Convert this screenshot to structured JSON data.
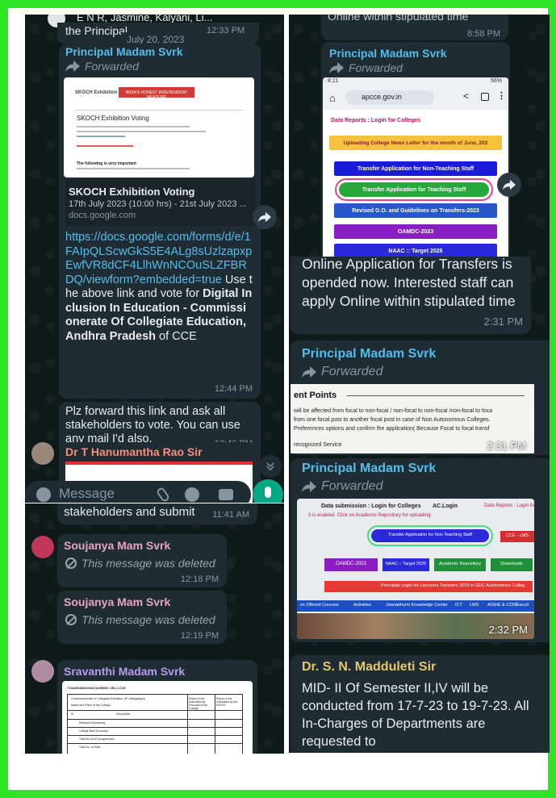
{
  "colors": {
    "border": "#2fe626",
    "panel_bg": "#0f1a1a",
    "bubble": "#1f2c33",
    "link": "#53bdeb",
    "sender": "#53bdeb",
    "mic": "#00a884"
  },
  "p1": {
    "top_partial": "E N R, Jasmine, Kalyani, Li...",
    "top_partial2": "the Principal...",
    "top_time": "12:33 PM",
    "date_chip": "July 20, 2023",
    "msg1": {
      "sender": "Principal Madam Svrk",
      "forwarded": "Forwarded",
      "preview_header": "SKOCH Exhibition",
      "preview_banner": "INDIA'S HONEST INDEPENDENT MEASURE",
      "preview_doc_title": "SKOCH Exhibition Voting",
      "preview_note": "The following is very important",
      "link_title": "SKOCH Exhibition Voting",
      "link_desc": "17th July 2023 (10:00 hrs) - 21st July 2023 ...",
      "link_domain": "docs.google.com",
      "url": "https://docs.google.com/forms/d/e/1FAIpQLScwGkS5E4ALg8sUzlzapxpEwfVR8dCF4LlhWnNCOuSLZFBRDQ/viewform?embedded=true",
      "text_a": "Use the above link and vote for ",
      "text_bold": "Digital Inclusion In Education - Commissionerate Of Collegiate Education, Andhra Pradesh",
      "text_b": " of CCE",
      "time": "12:44 PM"
    },
    "msg2": {
      "text": "Plz forward this link and ask all stakeholders to vote. You can use any mail I'd also.",
      "time": "12:46 PM"
    },
    "msg3": {
      "sender": "Dr T Hanumantha Rao Sir"
    },
    "composer": {
      "placeholder": "Message"
    }
  },
  "p2": {
    "top_text": "stakeholders and submit",
    "top_time": "11:41 AM",
    "msg1": {
      "sender": "Soujanya Mam Svrk",
      "deleted": "This message was deleted",
      "time": "12:18 PM"
    },
    "msg2": {
      "sender": "Soujanya Mam Svrk",
      "deleted": "This message was deleted",
      "time": "12:19 PM"
    },
    "msg3": {
      "sender": "Sravanthi Madam Svrk",
      "doc_heading": "7104206082023/ACADEMIC CELL-CCE",
      "doc_row1": "Commissionerate of Collegiate Education, AP (Mangalagiri)",
      "doc_row2": "Name and Place of the College:",
      "doc_col1": "Sl",
      "doc_col2": "Description",
      "doc_col3": "Report to be Submitted by Principal of the College",
      "doc_col4": "Report to be Submitted by the RJDCE",
      "doc_item1": "Research Monitoring",
      "doc_item2": "College Best Summary",
      "doc_item3": "Total No.of UG programmes",
      "doc_item4": "Total No. of Staff"
    }
  },
  "p3": {
    "top_text": "Online within stipulated time",
    "top_time": "8:58 PM",
    "msg1": {
      "sender": "Principal Madam Svrk",
      "forwarded": "Forwarded",
      "status_time": "8:11",
      "status_right": "56%",
      "url_bar": "apcce.gov.in",
      "site_header": "Data Reports : Login for Colleges",
      "btn1": "Uploading College News Letter for the month of June, 202",
      "btn2": "Transfer Application for Non-Teaching Staff",
      "btn3": "Transfer Application for Teaching Staff",
      "btn4": "Revised G.O. and Guidelines on Transfers-2023",
      "btn5": "OAMDC-2023",
      "btn6": "NAAC :: Target 2026"
    }
  },
  "p4": {
    "msg0": {
      "text": "Online Application for Transfers is opended now.  Interested staff can apply Online within stipulated time",
      "time": "2:31 PM"
    },
    "msg1": {
      "sender": "Principal Madam Svrk",
      "forwarded": "Forwarded",
      "doc_title": "ent Points",
      "doc_line1": "will be affected from focal to non-focal / non-focal to non-focal /non-focal to foca",
      "doc_line2": "from one focal post to another focal post in case of Non Autonomous Colleges.",
      "doc_line3": "Preferences options and confirm the application( Because Focal to focal transf",
      "doc_line4": "recognized Service",
      "time": "2:31 PM"
    },
    "msg2": {
      "sender": "Principal Madam Svrk",
      "forwarded": "Forwarded",
      "photo_line1": "Data submission : Login for Colleges",
      "photo_line1b": "AC.Login",
      "photo_line1c": "Data Reports : Login fo",
      "photo_line2": "3 is enabled. Click on Academic Repository for uploading",
      "photo_btn": "Transfer Application for Non Teaching Staff",
      "photo_btn_r": "CCE - LMS",
      "photo_row_a": "OAMDC-2023",
      "photo_row_b": "NAAC :: Target 2026",
      "photo_row_c": "Academic Repository",
      "photo_row_d": "Downloads",
      "photo_red": "Principals Login for Lecturers Transfers 2023 in GDC Autonomous Colleg",
      "photo_nav1": "es Offered Courses",
      "photo_nav2": "Activities",
      "photo_nav3": "Jnanabhumi Knowledge Center",
      "photo_nav4": "ICT",
      "photo_nav5": "LMS",
      "photo_nav6": "AISHE & CCRE",
      "photo_nav7": "Facult",
      "time": "2:32 PM"
    },
    "msg3": {
      "sender": "Dr. S. N. Madduleti Sir",
      "text": "MID- II Of Semester II,IV will be conducted from 17-7-23 to 19-7-23. All In-Charges of Departments are requested to"
    }
  }
}
